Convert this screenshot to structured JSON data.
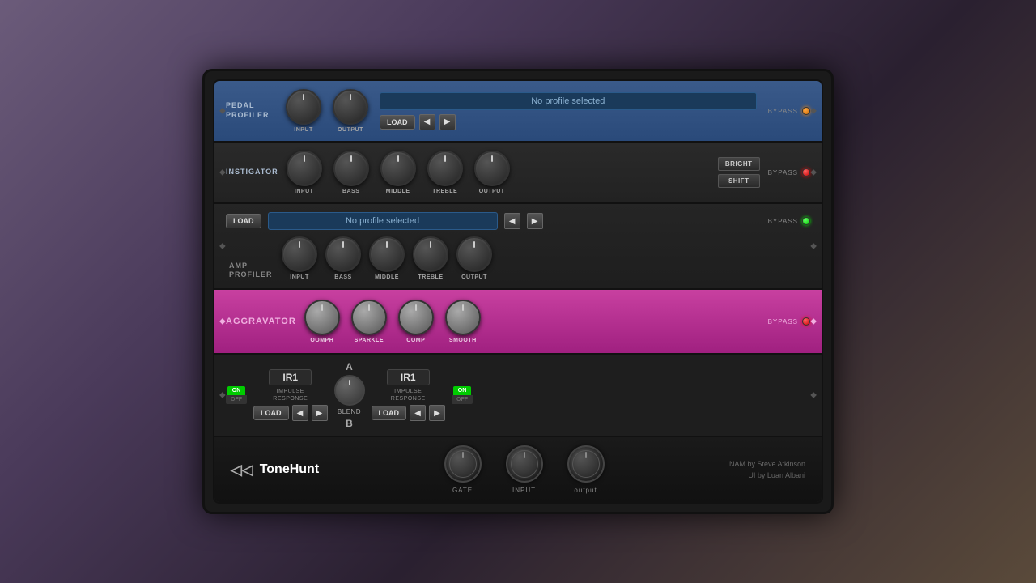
{
  "pedal_profiler": {
    "label_line1": "PEDAL",
    "label_line2": "PROFILER",
    "knob_input_label": "INPUT",
    "knob_output_label": "OUTPUT",
    "profile_display": "No profile selected",
    "load_btn": "LOAD",
    "bypass_label": "BYPASS"
  },
  "instigator": {
    "label": "INSTIGATOR",
    "knob_input_label": "INPUT",
    "knob_bass_label": "BASS",
    "knob_middle_label": "MIDDLE",
    "knob_treble_label": "TREBLE",
    "knob_output_label": "OUTPUT",
    "bright_btn": "BRIGHT",
    "shift_btn": "SHIFT",
    "bypass_label": "BYPASS"
  },
  "amp_profiler": {
    "label_line1": "AMP",
    "label_line2": "PROFILER",
    "profile_display": "No profile selected",
    "load_btn": "LOAD",
    "knob_input_label": "INPUT",
    "knob_bass_label": "BASS",
    "knob_middle_label": "MIDDLE",
    "knob_treble_label": "TREBLE",
    "knob_output_label": "OUTPUT",
    "bypass_label": "BYPASS"
  },
  "aggravator": {
    "label": "AGGRAVATOR",
    "knob_oomph_label": "OOMPH",
    "knob_sparkle_label": "SPARKLE",
    "knob_comp_label": "COMP",
    "knob_smooth_label": "SMOOTH",
    "bypass_label": "BYPASS"
  },
  "ir_section": {
    "ir1_a_label": "IR1",
    "ir1_a_sub": "IMPULSE\nRESPONSE",
    "load_a_btn": "LOAD",
    "a_label": "A",
    "blend_label": "BLEND",
    "b_label": "B",
    "ir1_b_label": "IR1",
    "ir1_b_sub": "IMPULSE\nRESPONSE",
    "load_b_btn": "LOAD",
    "on_label": "ON",
    "off_label": "OFF"
  },
  "footer": {
    "logo_text": "ToneHunt",
    "gate_label": "GATE",
    "input_label": "INPUT",
    "output_label": "output",
    "credit_line1": "NAM by Steve Atkinson",
    "credit_line2": "UI by Luan Albani"
  },
  "icons": {
    "prev": "◀",
    "next": "▶",
    "expand": "◆",
    "logo": "◁◁"
  }
}
